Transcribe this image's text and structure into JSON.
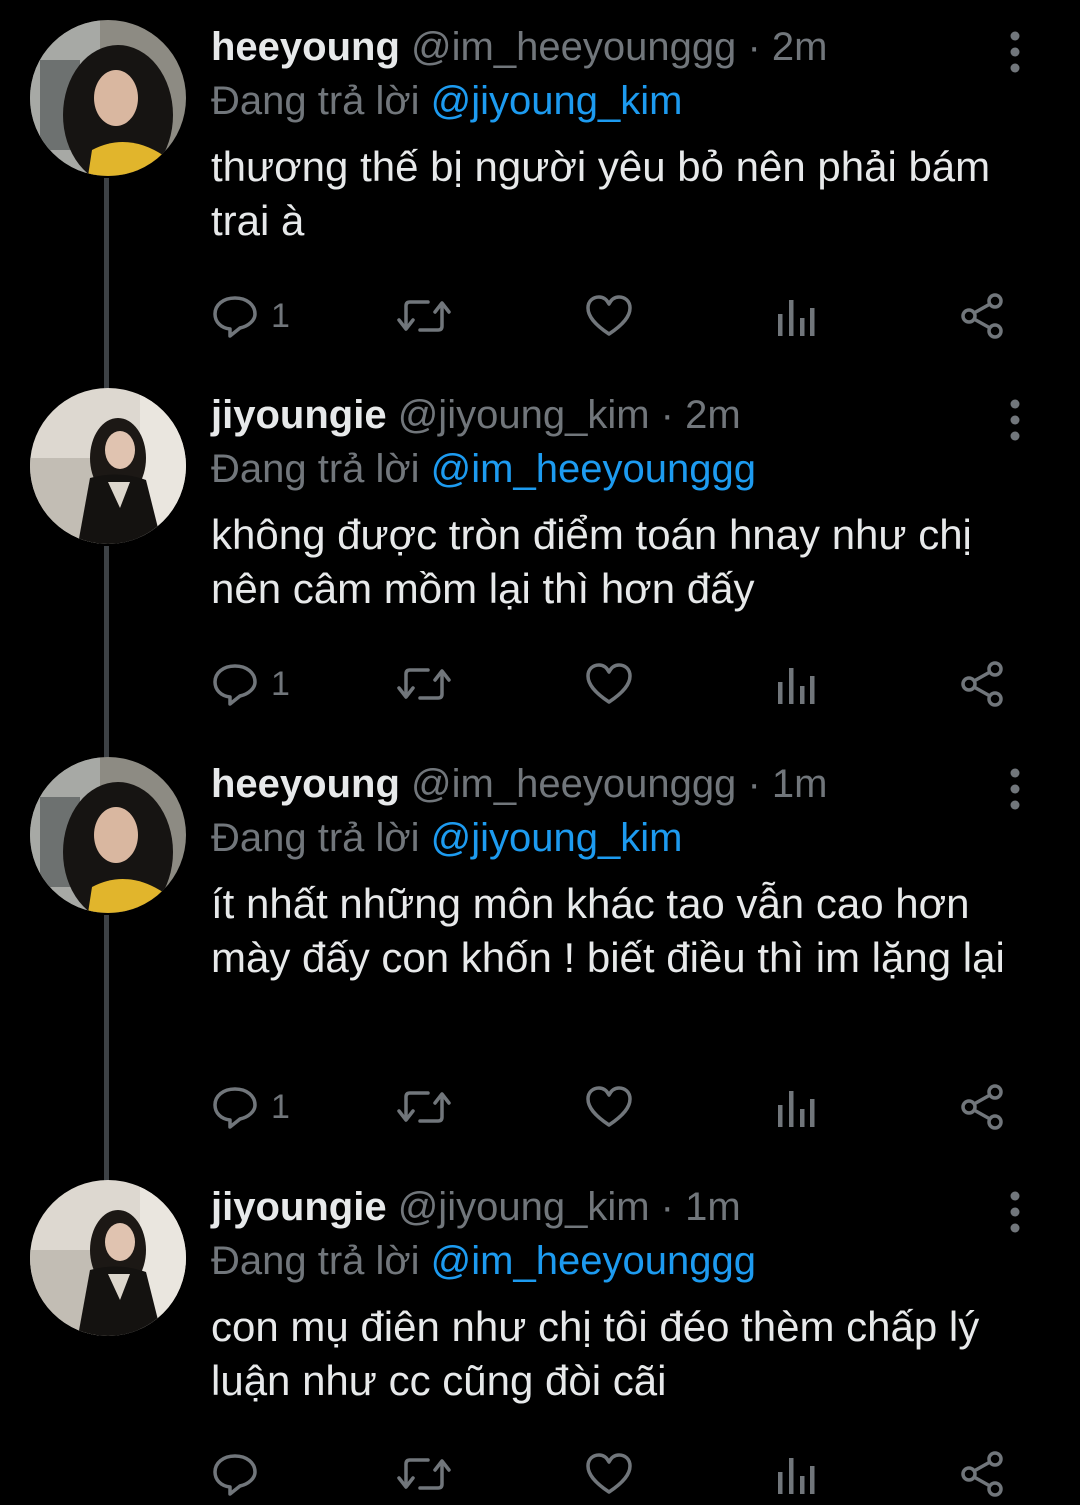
{
  "colors": {
    "background": "#000000",
    "name": "#e7e9ea",
    "secondary": "#71767b",
    "mention": "#1d9bf0",
    "thread_line": "#3d4145"
  },
  "tweets": [
    {
      "display_name": "heeyoung",
      "handle": "@im_heeyounggg",
      "separator": "·",
      "time": "2m",
      "reply_prefix": "Đang trả lời",
      "reply_to": "@jiyoung_kim",
      "text": "thương thế bị người yêu bỏ nên phải bám trai à",
      "reply_count": "1",
      "avatar": "avatar-heeyoung"
    },
    {
      "display_name": "jiyoungie",
      "handle": "@jiyoung_kim",
      "separator": "·",
      "time": "2m",
      "reply_prefix": "Đang trả lời",
      "reply_to": "@im_heeyounggg",
      "text": "không được tròn điểm toán hnay như chị nên câm mồm lại thì hơn đấy",
      "reply_count": "1",
      "avatar": "avatar-jiyoung"
    },
    {
      "display_name": "heeyoung",
      "handle": "@im_heeyounggg",
      "separator": "·",
      "time": "1m",
      "reply_prefix": "Đang trả lời",
      "reply_to": "@jiyoung_kim",
      "text": "ít nhất những môn khác tao vẫn cao hơn mày đấy con khốn ! biết điều thì im lặng lại",
      "reply_count": "1",
      "avatar": "avatar-heeyoung"
    },
    {
      "display_name": "jiyoungie",
      "handle": "@jiyoung_kim",
      "separator": "·",
      "time": "1m",
      "reply_prefix": "Đang trả lời",
      "reply_to": "@im_heeyounggg",
      "text": "con mụ điên như chị tôi đéo thèm chấp lý luận như cc cũng đòi cãi",
      "reply_count": "",
      "avatar": "avatar-jiyoung"
    }
  ],
  "action_icons": [
    "reply-icon",
    "retweet-icon",
    "like-icon",
    "analytics-icon",
    "share-icon"
  ],
  "more_icon": "more-vertical-icon"
}
